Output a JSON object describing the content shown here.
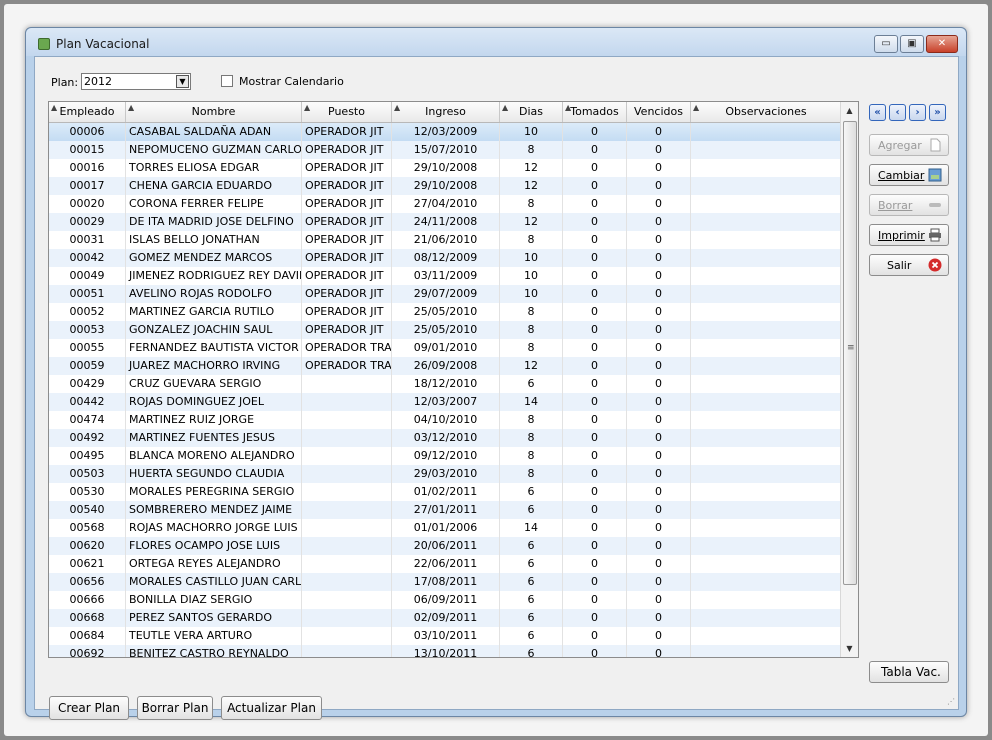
{
  "window": {
    "title": "Plan Vacacional",
    "minimize": "▭",
    "restore": "▣",
    "close": "✕"
  },
  "filter": {
    "plan_label": "Plan:",
    "plan_value": "2012",
    "calendar_label": "Mostrar Calendario"
  },
  "grid": {
    "columns": [
      "Empleado",
      "Nombre",
      "Puesto",
      "Ingreso",
      "Dias",
      "Tomados",
      "Vencidos",
      "Observaciones"
    ],
    "rows": [
      [
        "00006",
        "CASABAL SALDAÑA ADAN",
        "OPERADOR JIT",
        "12/03/2009",
        "10",
        "0",
        "0",
        ""
      ],
      [
        "00015",
        "NEPOMUCENO GUZMAN CARLOS",
        "OPERADOR JIT",
        "15/07/2010",
        "8",
        "0",
        "0",
        ""
      ],
      [
        "00016",
        "TORRES ELIOSA EDGAR",
        "OPERADOR JIT",
        "29/10/2008",
        "12",
        "0",
        "0",
        ""
      ],
      [
        "00017",
        "CHENA GARCIA EDUARDO",
        "OPERADOR JIT",
        "29/10/2008",
        "12",
        "0",
        "0",
        ""
      ],
      [
        "00020",
        "CORONA FERRER FELIPE",
        "OPERADOR JIT",
        "27/04/2010",
        "8",
        "0",
        "0",
        ""
      ],
      [
        "00029",
        "DE ITA MADRID JOSE DELFINO",
        "OPERADOR JIT",
        "24/11/2008",
        "12",
        "0",
        "0",
        ""
      ],
      [
        "00031",
        "ISLAS BELLO JONATHAN",
        "OPERADOR JIT",
        "21/06/2010",
        "8",
        "0",
        "0",
        ""
      ],
      [
        "00042",
        "GOMEZ MENDEZ MARCOS",
        "OPERADOR JIT",
        "08/12/2009",
        "10",
        "0",
        "0",
        ""
      ],
      [
        "00049",
        "JIMENEZ RODRIGUEZ REY DAVID",
        "OPERADOR JIT",
        "03/11/2009",
        "10",
        "0",
        "0",
        ""
      ],
      [
        "00051",
        "AVELINO ROJAS RODOLFO",
        "OPERADOR JIT",
        "29/07/2009",
        "10",
        "0",
        "0",
        ""
      ],
      [
        "00052",
        "MARTINEZ GARCIA RUTILO",
        "OPERADOR JIT",
        "25/05/2010",
        "8",
        "0",
        "0",
        ""
      ],
      [
        "00053",
        "GONZALEZ JOACHIN SAUL",
        "OPERADOR JIT",
        "25/05/2010",
        "8",
        "0",
        "0",
        ""
      ],
      [
        "00055",
        "FERNANDEZ BAUTISTA VICTOR OSCAR",
        "OPERADOR TRACT",
        "09/01/2010",
        "8",
        "0",
        "0",
        ""
      ],
      [
        "00059",
        "JUAREZ MACHORRO IRVING",
        "OPERADOR TRACT",
        "26/09/2008",
        "12",
        "0",
        "0",
        ""
      ],
      [
        "00429",
        "CRUZ GUEVARA SERGIO",
        "",
        "18/12/2010",
        "6",
        "0",
        "0",
        ""
      ],
      [
        "00442",
        "ROJAS DOMINGUEZ JOEL",
        "",
        "12/03/2007",
        "14",
        "0",
        "0",
        ""
      ],
      [
        "00474",
        "MARTINEZ RUIZ JORGE",
        "",
        "04/10/2010",
        "8",
        "0",
        "0",
        ""
      ],
      [
        "00492",
        "MARTINEZ FUENTES JESUS",
        "",
        "03/12/2010",
        "8",
        "0",
        "0",
        ""
      ],
      [
        "00495",
        "BLANCA MORENO ALEJANDRO",
        "",
        "09/12/2010",
        "8",
        "0",
        "0",
        ""
      ],
      [
        "00503",
        "HUERTA SEGUNDO CLAUDIA",
        "",
        "29/03/2010",
        "8",
        "0",
        "0",
        ""
      ],
      [
        "00530",
        "MORALES PEREGRINA SERGIO",
        "",
        "01/02/2011",
        "6",
        "0",
        "0",
        ""
      ],
      [
        "00540",
        "SOMBRERERO MENDEZ JAIME",
        "",
        "27/01/2011",
        "6",
        "0",
        "0",
        ""
      ],
      [
        "00568",
        "ROJAS MACHORRO JORGE LUIS",
        "",
        "01/01/2006",
        "14",
        "0",
        "0",
        ""
      ],
      [
        "00620",
        "FLORES OCAMPO JOSE LUIS",
        "",
        "20/06/2011",
        "6",
        "0",
        "0",
        ""
      ],
      [
        "00621",
        "ORTEGA REYES ALEJANDRO",
        "",
        "22/06/2011",
        "6",
        "0",
        "0",
        ""
      ],
      [
        "00656",
        "MORALES CASTILLO JUAN CARLOS",
        "",
        "17/08/2011",
        "6",
        "0",
        "0",
        ""
      ],
      [
        "00666",
        "BONILLA DIAZ SERGIO",
        "",
        "06/09/2011",
        "6",
        "0",
        "0",
        ""
      ],
      [
        "00668",
        "PEREZ SANTOS GERARDO",
        "",
        "02/09/2011",
        "6",
        "0",
        "0",
        ""
      ],
      [
        "00684",
        "TEUTLE VERA ARTURO",
        "",
        "03/10/2011",
        "6",
        "0",
        "0",
        ""
      ],
      [
        "00692",
        "BENITEZ CASTRO REYNALDO",
        "",
        "13/10/2011",
        "6",
        "0",
        "0",
        ""
      ]
    ]
  },
  "nav": {
    "first": "«",
    "prev": "‹",
    "next": "›",
    "last": "»"
  },
  "actions": {
    "agregar": "Agregar",
    "cambiar": "Cambiar",
    "borrar": "Borrar",
    "imprimir": "Imprimir",
    "salir": "Salir",
    "tabla_vac": "Tabla Vac."
  },
  "bottom": {
    "crear": "Crear Plan",
    "borrar": "Borrar Plan",
    "actualizar": "Actualizar Plan"
  },
  "colors": {
    "selection": "#c4dcf3",
    "alt_row": "#eaf2fb",
    "close_red": "#c8412a",
    "salir_red": "#d42a2a"
  }
}
